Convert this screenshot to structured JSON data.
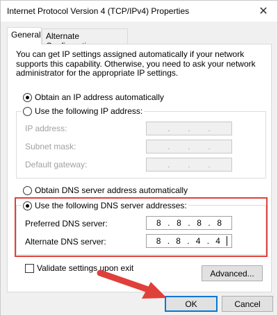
{
  "window": {
    "title": "Internet Protocol Version 4 (TCP/IPv4) Properties",
    "close_symbol": "✕"
  },
  "tabs": [
    {
      "label": "General",
      "active": true
    },
    {
      "label": "Alternate Configuration",
      "active": false
    }
  ],
  "description": "You can get IP settings assigned automatically if your network supports this capability. Otherwise, you need to ask your network administrator for the appropriate IP settings.",
  "ip_section": {
    "auto_label": "Obtain an IP address automatically",
    "auto_checked": true,
    "manual_label": "Use the following IP address:",
    "manual_checked": false,
    "fields": [
      {
        "label": "IP address:",
        "value": ". . ."
      },
      {
        "label": "Subnet mask:",
        "value": ". . ."
      },
      {
        "label": "Default gateway:",
        "value": ". . ."
      }
    ]
  },
  "dns_section": {
    "auto_label": "Obtain DNS server address automatically",
    "auto_checked": false,
    "manual_label": "Use the following DNS server addresses:",
    "manual_checked": true,
    "preferred": {
      "label": "Preferred DNS server:",
      "octets": [
        "8",
        "8",
        "8",
        "8"
      ]
    },
    "alternate": {
      "label": "Alternate DNS server:",
      "octets": [
        "8",
        "8",
        "4",
        "4"
      ]
    }
  },
  "validate": {
    "label": "Validate settings upon exit",
    "checked": false
  },
  "buttons": {
    "advanced": "Advanced...",
    "ok": "OK",
    "cancel": "Cancel"
  },
  "colors": {
    "highlight": "#e0403a",
    "arrow": "#e0403a",
    "ok_border": "#0078d7"
  }
}
